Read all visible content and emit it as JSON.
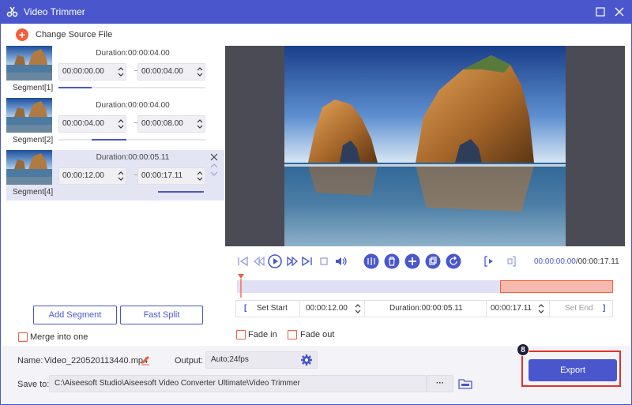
{
  "window": {
    "title": "Video Trimmer"
  },
  "toolbar": {
    "change_source_label": "Change Source File"
  },
  "segments": [
    {
      "label": "Segment[1]",
      "duration": "Duration:00:00:04.00",
      "start": "00:00:00.00",
      "end": "00:00:04.00",
      "active": false
    },
    {
      "label": "Segment[2]",
      "duration": "Duration:00:00:04.00",
      "start": "00:00:04.00",
      "end": "00:00:08.00",
      "active": false
    },
    {
      "label": "Segment[4]",
      "duration": "Duration:00:00:05.11",
      "start": "00:00:12.00",
      "end": "00:00:17.11",
      "active": true
    }
  ],
  "left_actions": {
    "add_segment": "Add Segment",
    "fast_split": "Fast Split",
    "merge_label": "Merge into one"
  },
  "player": {
    "current_time": "00:00:00.00",
    "total_time": "/00:00:17.11"
  },
  "timeline": {
    "selection_start_fraction": 0.7,
    "selection_end_fraction": 1.0
  },
  "set_row": {
    "set_start": "Set Start",
    "start_value": "00:00:12.00",
    "duration": "Duration:00:00:05.11",
    "end_value": "00:00:17.11",
    "set_end": "Set End"
  },
  "effects": {
    "fade_in": "Fade in",
    "fade_out": "Fade out"
  },
  "output": {
    "name_label": "Name:",
    "name_value": "Video_220520113440.mp4",
    "output_label": "Output:",
    "output_value": "Auto;24fps",
    "save_label": "Save to:",
    "save_path": "C:\\Aiseesoft Studio\\Aiseesoft Video Converter Ultimate\\Video Trimmer",
    "browse_dots": "···",
    "export_label": "Export",
    "step_badge": "8"
  },
  "colors": {
    "accent": "#4a57cc",
    "orange": "#f25e3d",
    "highlight_red": "#e0312b"
  }
}
